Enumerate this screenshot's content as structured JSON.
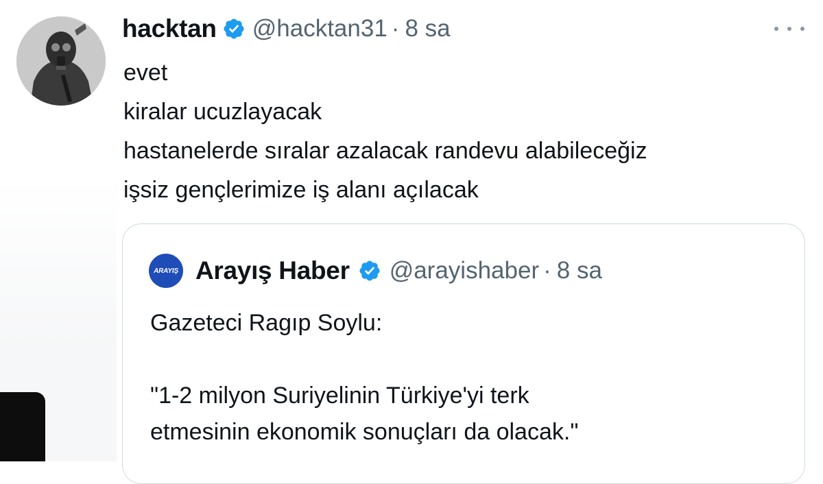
{
  "tweet": {
    "display_name": "hacktan",
    "handle": "@hacktan31",
    "separator": "·",
    "time": "8 sa",
    "lines": [
      "evet",
      "kiralar ucuzlayacak",
      "hastanelerde sıralar azalacak randevu alabileceğiz",
      "işsiz gençlerimize iş alanı açılacak"
    ]
  },
  "quote": {
    "avatar_text": "ARAYIŞ",
    "display_name": "Arayış Haber",
    "handle": "@arayishaber",
    "separator": "·",
    "time": "8 sa",
    "lines": [
      "Gazeteci Ragıp Soylu:",
      "",
      "\"1-2 milyon Suriyelinin Türkiye'yi terk",
      "etmesinin ekonomik sonuçları da olacak.\""
    ]
  },
  "icons": {
    "verified": "verified-badge-icon",
    "more": "more-horizontal-icon"
  },
  "colors": {
    "verified_blue": "#1d9bf0",
    "secondary_text": "#536471",
    "primary_text": "#0f1419",
    "border": "#cfd9de",
    "quote_avatar_bg": "#1e4db7"
  }
}
